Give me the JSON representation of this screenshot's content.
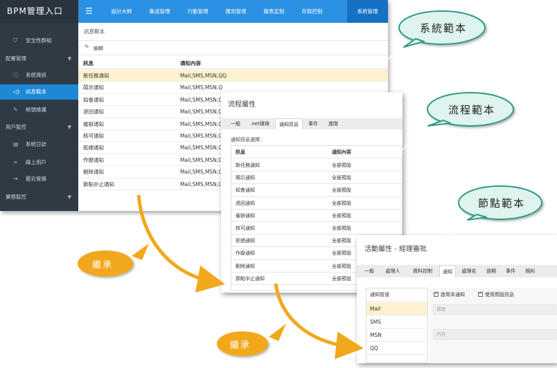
{
  "app": {
    "brand": "BPM管理入口",
    "nav_tabs": [
      "設計大師",
      "集成管理",
      "行動管理",
      "應用管理",
      "報表定制",
      "存取控制",
      "系統管理"
    ],
    "active_nav": "系統管理"
  },
  "sidebar": {
    "items": [
      {
        "label": "安全性群組",
        "icon": "shield-icon",
        "type": "item"
      },
      {
        "label": "配置管理",
        "type": "group"
      },
      {
        "label": "系統資訊",
        "icon": "info-icon",
        "type": "item"
      },
      {
        "label": "訊息範本",
        "icon": "speaker-icon",
        "type": "item",
        "active": true
      },
      {
        "label": "帳號維護",
        "icon": "wrench-icon",
        "type": "item"
      },
      {
        "label": "用戶監控",
        "type": "group"
      },
      {
        "label": "系統日誌",
        "icon": "log-icon",
        "type": "item"
      },
      {
        "label": "線上用戶",
        "icon": "link-icon",
        "type": "item"
      },
      {
        "label": "最近登錄",
        "icon": "login-icon",
        "type": "item"
      },
      {
        "label": "業務監控",
        "type": "group"
      }
    ]
  },
  "main": {
    "breadcrumb": "訊息範本",
    "edit_label": "編輯",
    "columns": [
      "訊息",
      "通知內容"
    ],
    "rows": [
      {
        "name": "新任務通知",
        "content": "Mail,SMS,MSN,QQ",
        "selected": true
      },
      {
        "name": "鬧示通知",
        "content": "Mail,SMS,MSN,Q"
      },
      {
        "name": "知會通知",
        "content": "Mail,SMS,MSN,Q"
      },
      {
        "name": "退回通知",
        "content": "Mail,SMS,MSN,Q"
      },
      {
        "name": "催辦通知",
        "content": "Mail,SMS,MSN,Q"
      },
      {
        "name": "核可通知",
        "content": "Mail,SMS,MSN,Q"
      },
      {
        "name": "拒絕通知",
        "content": "Mail,SMS,MSN,Q"
      },
      {
        "name": "作廢通知",
        "content": "Mail,SMS,MSN,Q"
      },
      {
        "name": "刪除通知",
        "content": "Mail,SMS,MSN,Q"
      },
      {
        "name": "節點中止通知",
        "content": "Mail,SMS,MSN,Q"
      }
    ]
  },
  "flow_dialog": {
    "title": "流程屬性",
    "tabs": [
      "一般",
      ".net環境",
      "通知訊息",
      "事件",
      "進階"
    ],
    "active_tab": "通知訊息",
    "caption": "通知訊息選擇：",
    "columns": [
      "訊息",
      "通知內容"
    ],
    "rows": [
      {
        "name": "新任務通知",
        "content": "全部預設"
      },
      {
        "name": "鬧示通知",
        "content": "全部預設"
      },
      {
        "name": "知會通知",
        "content": "全部預設"
      },
      {
        "name": "退回通知",
        "content": "全部預設"
      },
      {
        "name": "催辦通知",
        "content": "全部預設"
      },
      {
        "name": "核可通知",
        "content": "全部預設"
      },
      {
        "name": "拒絕通知",
        "content": "全部預設"
      },
      {
        "name": "作廢通知",
        "content": "全部預設"
      },
      {
        "name": "刪除通知",
        "content": "全部預設"
      },
      {
        "name": "節點中止通知",
        "content": "全部預設"
      }
    ]
  },
  "node_dialog": {
    "title": "活動屬性 - 經理審批",
    "tabs": [
      "一般",
      "處理人",
      "資料控制",
      "通知",
      "處理名",
      "逾期",
      "事件",
      "規則"
    ],
    "active_tab": "通知",
    "channel_header": "通知管道",
    "channels": [
      "Mail",
      "SMS",
      "MSN",
      "QQ"
    ],
    "selected_channel": "Mail",
    "checkbox_enable": "啟用本通知",
    "checkbox_default": "使用預設訊息",
    "title_placeholder": "標題",
    "content_placeholder": "內容"
  },
  "callouts": {
    "system_template": "系統範本",
    "flow_template": "流程範本",
    "node_template": "節點範本",
    "inherit": "繼承"
  },
  "colors": {
    "topbar": "#2b91e3",
    "sidebar": "#2f3a45",
    "selected_row": "#fdf1cf",
    "callout_fill": "#dff4ee",
    "callout_stroke": "#2f9a86",
    "arrow": "#f2a81d"
  }
}
